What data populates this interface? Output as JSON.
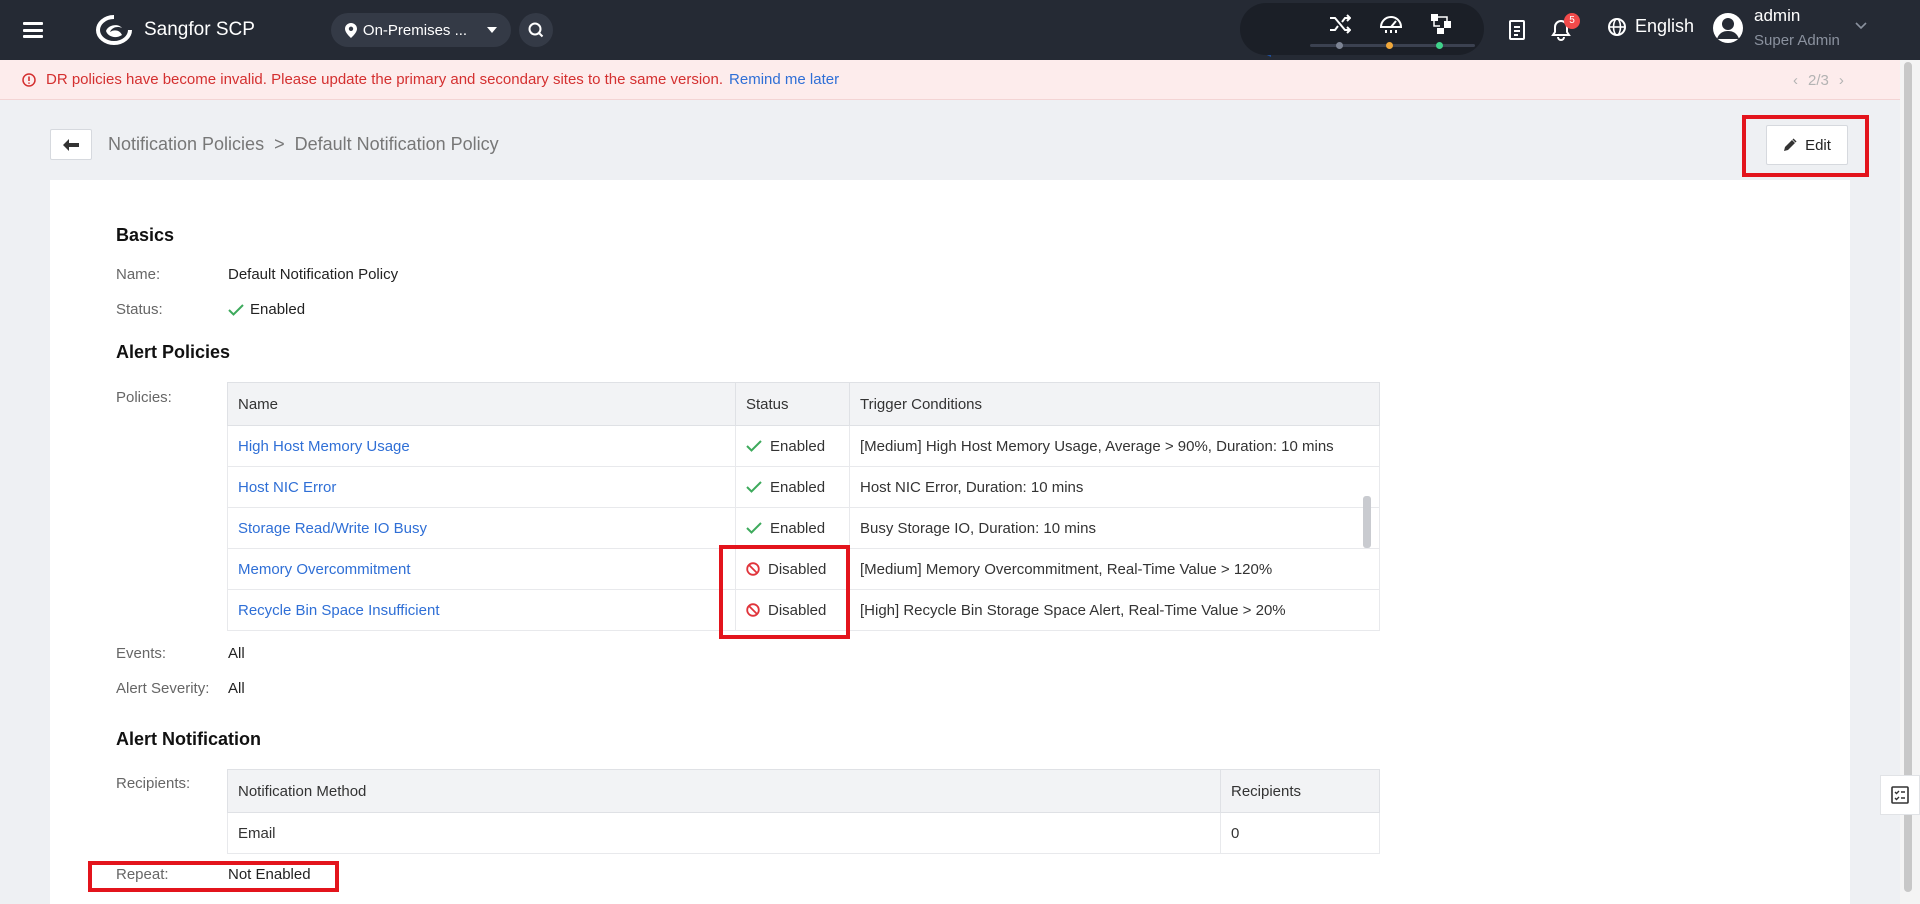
{
  "header": {
    "app_title": "Sangfor SCP",
    "site_selector": "On-Premises ...",
    "notifications_count": "5",
    "language": "English",
    "user_name": "admin",
    "user_role": "Super Admin"
  },
  "alert_bar": {
    "message": "DR policies have become invalid. Please update the primary and secondary sites to the same version.",
    "remind_link": "Remind me later",
    "pager": "2/3"
  },
  "breadcrumb": {
    "parent": "Notification Policies",
    "separator": ">",
    "current": "Default Notification Policy"
  },
  "toolbar": {
    "edit_label": "Edit"
  },
  "basics": {
    "title": "Basics",
    "name_label": "Name:",
    "name_value": "Default Notification Policy",
    "status_label": "Status:",
    "status_value": "Enabled"
  },
  "alert_policies": {
    "title": "Alert Policies",
    "policies_label": "Policies:",
    "columns": [
      "Name",
      "Status",
      "Trigger Conditions"
    ],
    "rows": [
      {
        "name": "High Host Memory Usage",
        "status": "Enabled",
        "trigger": "[Medium] High Host Memory Usage, Average > 90%, Duration: 10 mins"
      },
      {
        "name": "Host NIC Error",
        "status": "Enabled",
        "trigger": "Host NIC Error, Duration: 10 mins"
      },
      {
        "name": "Storage Read/Write IO Busy",
        "status": "Enabled",
        "trigger": "Busy Storage IO, Duration: 10 mins"
      },
      {
        "name": "Memory Overcommitment",
        "status": "Disabled",
        "trigger": "[Medium] Memory Overcommitment, Real-Time Value > 120%"
      },
      {
        "name": "Recycle Bin Space Insufficient",
        "status": "Disabled",
        "trigger": "[High] Recycle Bin Storage Space Alert, Real-Time Value > 20%"
      }
    ],
    "events_label": "Events:",
    "events_value": "All",
    "severity_label": "Alert Severity:",
    "severity_value": "All"
  },
  "alert_notification": {
    "title": "Alert Notification",
    "recipients_label": "Recipients:",
    "columns": [
      "Notification Method",
      "Recipients"
    ],
    "rows": [
      {
        "method": "Email",
        "recipients": "0"
      }
    ],
    "repeat_label": "Repeat:",
    "repeat_value": "Not Enabled"
  },
  "colors": {
    "topbar": "#252a34",
    "link": "#2f6fd6",
    "enabled_check": "#3daa5c",
    "disabled_icon": "#e0343b",
    "highlight": "#e3141c"
  }
}
